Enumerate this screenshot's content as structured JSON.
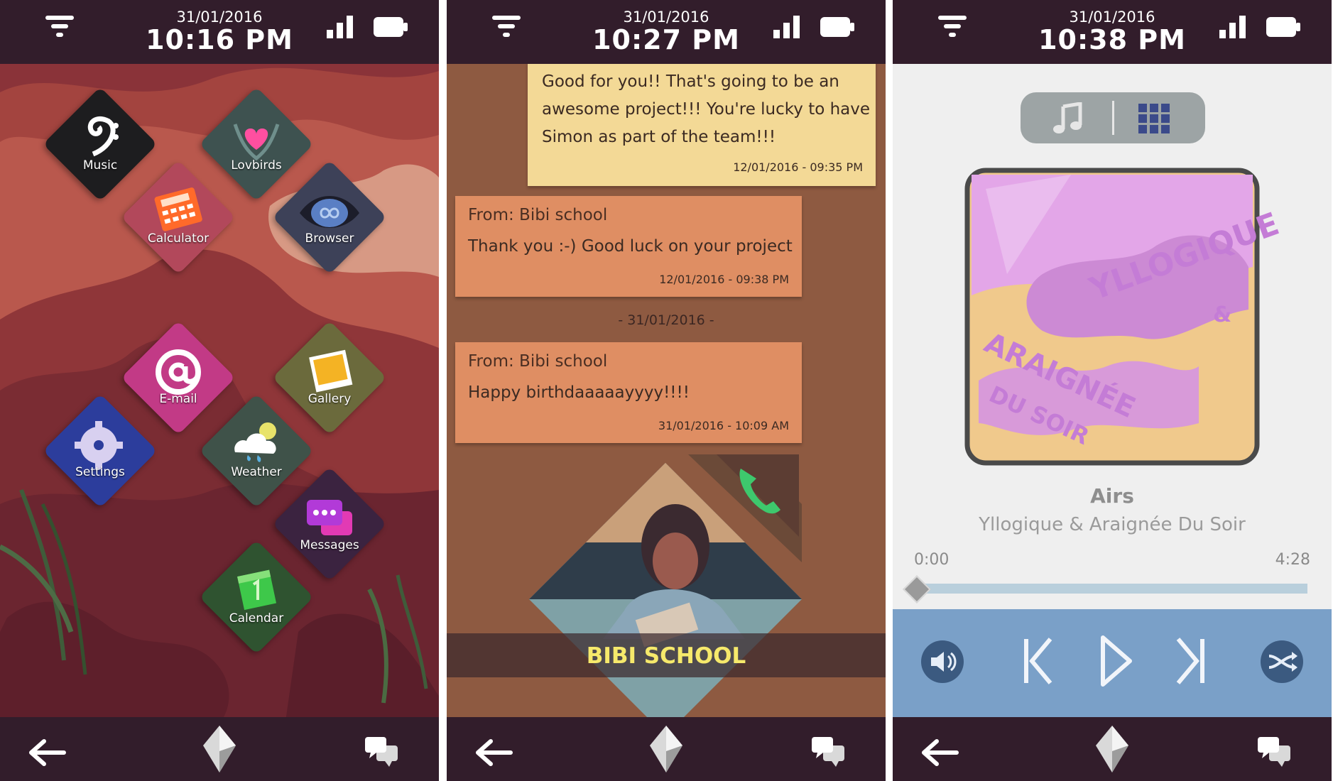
{
  "screens": [
    {
      "status": {
        "date": "31/01/2016",
        "time": "10:16 PM"
      },
      "apps": [
        {
          "label": "Music",
          "color": "#1d1d1f"
        },
        {
          "label": "Lovbirds",
          "color": "#3e5250"
        },
        {
          "label": "Calculator",
          "color": "#b2485b"
        },
        {
          "label": "Browser",
          "color": "#3d4158"
        },
        {
          "label": "E-mail",
          "color": "#c23a86"
        },
        {
          "label": "Gallery",
          "color": "#6b6a3c"
        },
        {
          "label": "Settings",
          "color": "#2c3d9c"
        },
        {
          "label": "Weather",
          "color": "#3f5249"
        },
        {
          "label": "Messages",
          "color": "#3b2340"
        },
        {
          "label": "Calendar",
          "color": "#2f5330"
        }
      ]
    },
    {
      "status": {
        "date": "31/01/2016",
        "time": "10:27 PM"
      },
      "messages": [
        {
          "type": "sent",
          "lines": [
            "Good for you!! That's going to be an",
            "awesome project!!! You're lucky to have",
            "Simon as part of the team!!!"
          ],
          "time": "12/01/2016 - 09:35 PM"
        },
        {
          "type": "received",
          "from": "From: Bibi school",
          "lines": [
            "Thank you :-) Good luck on your project"
          ],
          "time": "12/01/2016 - 09:38 PM"
        },
        {
          "type": "received",
          "from": "From: Bibi school",
          "lines": [
            "Happy birthdaaaaayyyy!!!!"
          ],
          "time": "31/01/2016 - 10:09 AM"
        }
      ],
      "date_separator": "- 31/01/2016 -",
      "contact_name": "BIBI SCHOOL"
    },
    {
      "status": {
        "date": "31/01/2016",
        "time": "10:38 PM"
      },
      "track": {
        "title": "Airs",
        "artist": "Yllogique & Araignée Du Soir"
      },
      "album_art_text": [
        "YLLOGIQUE",
        "&",
        "ARAIGNÉE",
        "DU SOIR"
      ],
      "elapsed": "0:00",
      "duration": "4:28",
      "progress": 0.0
    }
  ],
  "colors": {
    "bar": "#321d2b",
    "accent_green": "#3ec86d",
    "contact_yellow": "#f6e96b",
    "player_blue": "#7aa0c8"
  }
}
